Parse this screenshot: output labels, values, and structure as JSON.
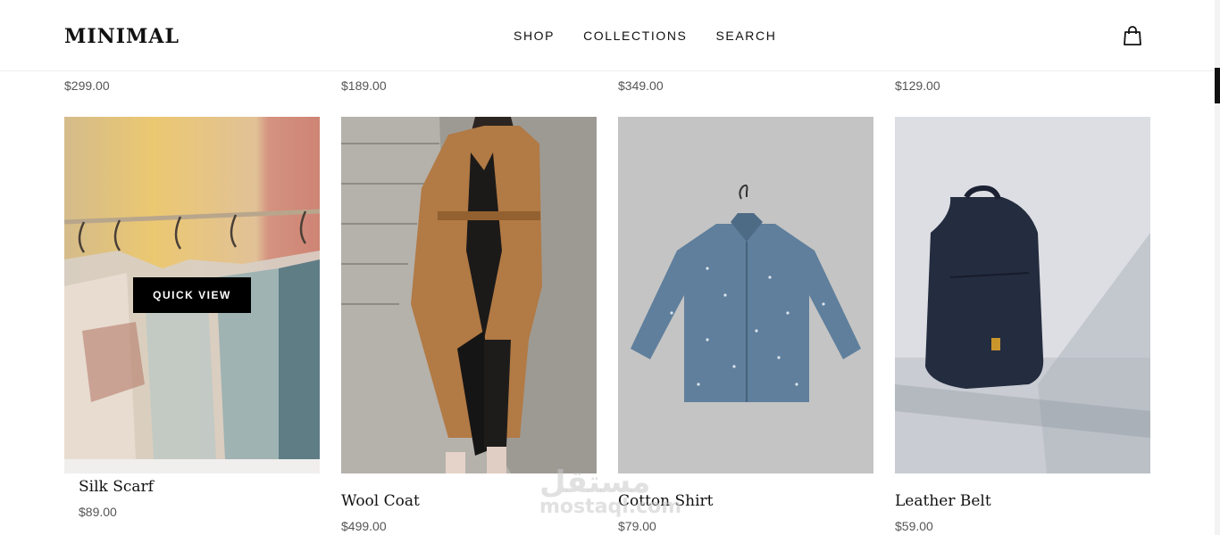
{
  "header": {
    "logo": "MINIMAL",
    "nav": [
      "SHOP",
      "COLLECTIONS",
      "SEARCH"
    ],
    "cart_icon": "shopping-bag-icon"
  },
  "previous_row_prices": [
    "$299.00",
    "$189.00",
    "$349.00",
    "$129.00"
  ],
  "products": [
    {
      "name": "Silk Scarf",
      "price": "$89.00",
      "quick_view": "QUICK VIEW"
    },
    {
      "name": "Wool Coat",
      "price": "$499.00"
    },
    {
      "name": "Cotton Shirt",
      "price": "$79.00"
    },
    {
      "name": "Leather Belt",
      "price": "$59.00"
    }
  ],
  "watermark": {
    "line1": "مستقل",
    "line2": "mostaql.com"
  }
}
